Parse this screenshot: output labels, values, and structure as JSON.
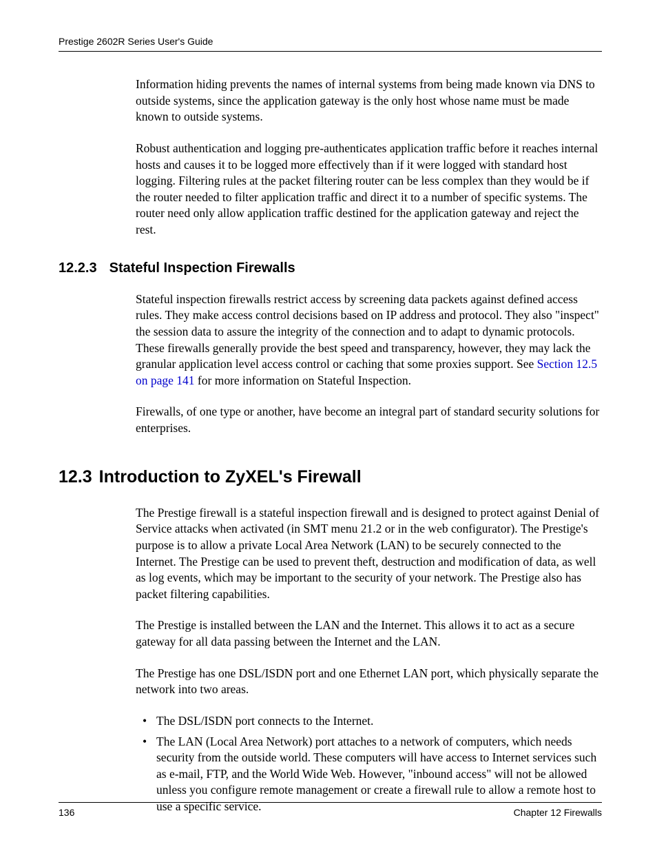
{
  "header": {
    "title": "Prestige 2602R Series User's Guide"
  },
  "paragraphs": {
    "p1": "Information hiding prevents the names of internal systems from being made known via DNS to outside systems, since the application gateway is the only host whose name must be made known to outside systems.",
    "p2": "Robust authentication and logging pre-authenticates application traffic before it reaches internal hosts and causes it to be logged more effectively than if it were logged with standard host logging. Filtering rules at the packet filtering router can be less complex than they would be if the router needed to filter application traffic and direct it to a number of specific systems. The router need only allow application traffic destined for the application gateway and reject the rest.",
    "p3_pre": "Stateful inspection firewalls restrict access by screening data packets against defined access rules. They make access control decisions based on IP address and protocol. They also \"inspect\" the session data to assure the integrity of the connection and to adapt to dynamic protocols. These firewalls generally provide the best speed and transparency, however, they may lack the granular application level access control or caching that some proxies support. See ",
    "p3_link": "Section 12.5 on page 141",
    "p3_post": " for more information on Stateful Inspection.",
    "p4": "Firewalls, of one type or another, have become an integral part of standard security solutions for enterprises.",
    "p5": "The Prestige firewall is a stateful inspection firewall and is designed to protect against Denial of Service attacks when activated (in SMT menu 21.2 or in the web configurator). The Prestige's purpose is to allow a private Local Area Network (LAN) to be securely connected to the Internet. The Prestige can be used to prevent theft, destruction and modification of data, as well as log events, which may be important to the security of your network. The Prestige also has packet filtering capabilities.",
    "p6": "The Prestige is installed between the LAN and the Internet. This allows it to act as a secure gateway for all data passing between the Internet and the LAN.",
    "p7": "The Prestige has one DSL/ISDN port and one Ethernet LAN port, which physically separate the network into two areas."
  },
  "headings": {
    "h3_num": "12.2.3",
    "h3_text": "Stateful Inspection Firewalls",
    "h2_num": "12.3",
    "h2_text": "Introduction to ZyXEL's Firewall"
  },
  "bullets": {
    "b1": "The DSL/ISDN port connects to the Internet.",
    "b2": "The LAN (Local Area Network) port attaches to a network of computers, which needs security from the outside world. These computers will have access to Internet services such as e-mail, FTP, and the World Wide Web.  However, \"inbound access\" will not be allowed unless you configure remote management or create a firewall rule to allow a remote host to use a specific service."
  },
  "footer": {
    "page": "136",
    "chapter": "Chapter 12 Firewalls"
  }
}
